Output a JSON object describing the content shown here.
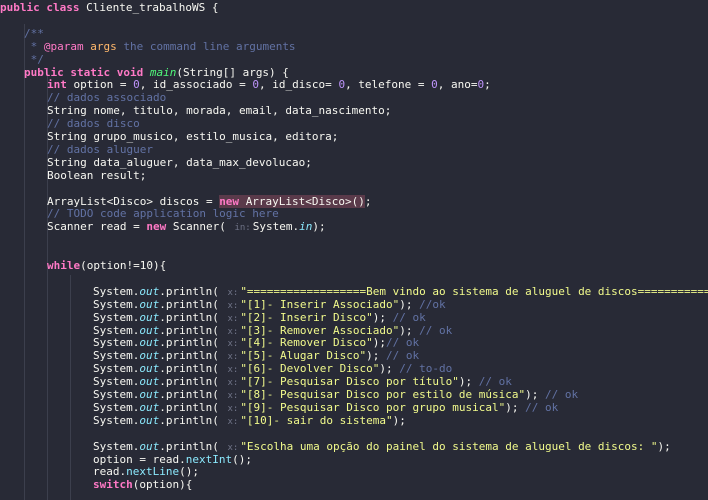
{
  "editor": {
    "lines": [
      {
        "indent": 0,
        "tokens": [
          [
            "kw",
            "public class "
          ],
          [
            "cls",
            "Cliente_trabalhoWS {"
          ]
        ]
      },
      {
        "indent": 0,
        "tokens": []
      },
      {
        "indent": 24,
        "tokens": [
          [
            "doc",
            "/**"
          ]
        ]
      },
      {
        "indent": 24,
        "tokens": [
          [
            "doc",
            " * "
          ],
          [
            "doctag",
            "@param"
          ],
          [
            "docparam",
            " args"
          ],
          [
            "doc",
            " the command line arguments"
          ]
        ]
      },
      {
        "indent": 24,
        "tokens": [
          [
            "doc",
            " */"
          ]
        ]
      },
      {
        "indent": 24,
        "tokens": [
          [
            "kw",
            "public static void "
          ],
          [
            "fn",
            "main"
          ],
          [
            "cls",
            "(String[] args) {"
          ]
        ]
      },
      {
        "indent": 47,
        "tokens": [
          [
            "kw",
            "int "
          ],
          [
            "cls",
            "option = "
          ],
          [
            "num",
            "0"
          ],
          [
            "cls",
            ", id_associado = "
          ],
          [
            "num",
            "0"
          ],
          [
            "cls",
            ", id_disco= "
          ],
          [
            "num",
            "0"
          ],
          [
            "cls",
            ", telefone = "
          ],
          [
            "num",
            "0"
          ],
          [
            "cls",
            ", ano="
          ],
          [
            "num",
            "0"
          ],
          [
            "cls",
            ";"
          ]
        ]
      },
      {
        "indent": 47,
        "tokens": [
          [
            "cm",
            "// dados associado"
          ]
        ]
      },
      {
        "indent": 47,
        "tokens": [
          [
            "cls",
            "String nome, titulo, morada, email, data_nascimento;"
          ]
        ]
      },
      {
        "indent": 47,
        "tokens": [
          [
            "cm",
            "// dados disco"
          ]
        ]
      },
      {
        "indent": 47,
        "tokens": [
          [
            "cls",
            "String grupo_musico, estilo_musica, editora;"
          ]
        ]
      },
      {
        "indent": 47,
        "tokens": [
          [
            "cm",
            "// dados aluguer"
          ]
        ]
      },
      {
        "indent": 47,
        "tokens": [
          [
            "cls",
            "String data_aluguer, data_max_devolucao;"
          ]
        ]
      },
      {
        "indent": 47,
        "tokens": [
          [
            "cls",
            "Boolean result;"
          ]
        ]
      },
      {
        "indent": 0,
        "tokens": []
      },
      {
        "indent": 47,
        "tokens": [
          [
            "cls",
            "ArrayList<Disco> discos = "
          ],
          [
            "kwhl",
            "new "
          ],
          [
            "hlc",
            "ArrayList<Disco>()"
          ],
          [
            "cls",
            ";"
          ]
        ]
      },
      {
        "indent": 47,
        "tokens": [
          [
            "cm",
            "// TODO code application logic here"
          ]
        ]
      },
      {
        "indent": 47,
        "tokens": [
          [
            "cls",
            "Scanner read = "
          ],
          [
            "kw",
            "new "
          ],
          [
            "cls",
            "Scanner( "
          ],
          [
            "hint",
            "in:"
          ],
          [
            "cls",
            "System."
          ],
          [
            "field",
            "in"
          ],
          [
            "cls",
            ");"
          ]
        ]
      },
      {
        "indent": 0,
        "tokens": []
      },
      {
        "indent": 0,
        "tokens": []
      },
      {
        "indent": 47,
        "tokens": [
          [
            "kw",
            "while"
          ],
          [
            "cls",
            "(option!=10){"
          ]
        ]
      },
      {
        "indent": 0,
        "tokens": []
      },
      {
        "indent": 93,
        "tokens": [
          [
            "cls",
            "System."
          ],
          [
            "field",
            "out"
          ],
          [
            "cls",
            ".println( "
          ],
          [
            "hint",
            "x:"
          ],
          [
            "str",
            "\"==================Bem vindo ao sistema de aluguel de discos==================\""
          ],
          [
            "cls",
            ");"
          ]
        ]
      },
      {
        "indent": 93,
        "tokens": [
          [
            "cls",
            "System."
          ],
          [
            "field",
            "out"
          ],
          [
            "cls",
            ".println( "
          ],
          [
            "hint",
            "x:"
          ],
          [
            "str",
            "\"[1]- Inserir Associado\""
          ],
          [
            "cls",
            "); "
          ],
          [
            "cm",
            "//ok"
          ]
        ]
      },
      {
        "indent": 93,
        "tokens": [
          [
            "cls",
            "System."
          ],
          [
            "field",
            "out"
          ],
          [
            "cls",
            ".println( "
          ],
          [
            "hint",
            "x:"
          ],
          [
            "str",
            "\"[2]- Inserir Disco\""
          ],
          [
            "cls",
            "); "
          ],
          [
            "cm",
            "// ok"
          ]
        ]
      },
      {
        "indent": 93,
        "tokens": [
          [
            "cls",
            "System."
          ],
          [
            "field",
            "out"
          ],
          [
            "cls",
            ".println( "
          ],
          [
            "hint",
            "x:"
          ],
          [
            "str",
            "\"[3]- Remover Associado\""
          ],
          [
            "cls",
            "); "
          ],
          [
            "cm",
            "// ok"
          ]
        ]
      },
      {
        "indent": 93,
        "tokens": [
          [
            "cls",
            "System."
          ],
          [
            "field",
            "out"
          ],
          [
            "cls",
            ".println( "
          ],
          [
            "hint",
            "x:"
          ],
          [
            "str",
            "\"[4]- Remover Disco\""
          ],
          [
            "cls",
            ");"
          ],
          [
            "cm",
            "// ok"
          ]
        ]
      },
      {
        "indent": 93,
        "tokens": [
          [
            "cls",
            "System."
          ],
          [
            "field",
            "out"
          ],
          [
            "cls",
            ".println( "
          ],
          [
            "hint",
            "x:"
          ],
          [
            "str",
            "\"[5]- Alugar Disco\""
          ],
          [
            "cls",
            "); "
          ],
          [
            "cm",
            "// ok"
          ]
        ]
      },
      {
        "indent": 93,
        "tokens": [
          [
            "cls",
            "System."
          ],
          [
            "field",
            "out"
          ],
          [
            "cls",
            ".println( "
          ],
          [
            "hint",
            "x:"
          ],
          [
            "str",
            "\"[6]- Devolver Disco\""
          ],
          [
            "cls",
            "); "
          ],
          [
            "cm",
            "// to-do"
          ]
        ]
      },
      {
        "indent": 93,
        "tokens": [
          [
            "cls",
            "System."
          ],
          [
            "field",
            "out"
          ],
          [
            "cls",
            ".println( "
          ],
          [
            "hint",
            "x:"
          ],
          [
            "str",
            "\"[7]- Pesquisar Disco por título\""
          ],
          [
            "cls",
            "); "
          ],
          [
            "cm",
            "// ok"
          ]
        ]
      },
      {
        "indent": 93,
        "tokens": [
          [
            "cls",
            "System."
          ],
          [
            "field",
            "out"
          ],
          [
            "cls",
            ".println( "
          ],
          [
            "hint",
            "x:"
          ],
          [
            "str",
            "\"[8]- Pesquisar Disco por estilo de música\""
          ],
          [
            "cls",
            "); "
          ],
          [
            "cm",
            "// ok"
          ]
        ]
      },
      {
        "indent": 93,
        "tokens": [
          [
            "cls",
            "System."
          ],
          [
            "field",
            "out"
          ],
          [
            "cls",
            ".println( "
          ],
          [
            "hint",
            "x:"
          ],
          [
            "str",
            "\"[9]- Pesquisar Disco por grupo musical\""
          ],
          [
            "cls",
            "); "
          ],
          [
            "cm",
            "// ok"
          ]
        ]
      },
      {
        "indent": 93,
        "tokens": [
          [
            "cls",
            "System."
          ],
          [
            "field",
            "out"
          ],
          [
            "cls",
            ".println( "
          ],
          [
            "hint",
            "x:"
          ],
          [
            "str",
            "\"[10]- sair do sistema\""
          ],
          [
            "cls",
            ");"
          ]
        ]
      },
      {
        "indent": 0,
        "tokens": []
      },
      {
        "indent": 93,
        "tokens": [
          [
            "cls",
            "System."
          ],
          [
            "field",
            "out"
          ],
          [
            "cls",
            ".println( "
          ],
          [
            "hint",
            "x:"
          ],
          [
            "str",
            "\"Escolha uma opção do painel do sistema de aluguel de discos: \""
          ],
          [
            "cls",
            ");"
          ]
        ]
      },
      {
        "indent": 93,
        "tokens": [
          [
            "cls",
            "option = read."
          ],
          [
            "method",
            "nextInt"
          ],
          [
            "cls",
            "();"
          ]
        ]
      },
      {
        "indent": 93,
        "tokens": [
          [
            "cls",
            "read."
          ],
          [
            "method",
            "nextLine"
          ],
          [
            "cls",
            "();"
          ]
        ]
      },
      {
        "indent": 93,
        "tokens": [
          [
            "kw",
            "switch"
          ],
          [
            "cls",
            "(option){"
          ]
        ]
      }
    ]
  },
  "colors": {
    "background": "#282a36",
    "keyword": "#ff79c6",
    "string": "#f1fa8c",
    "number": "#bd93f9",
    "comment": "#6272a4"
  }
}
